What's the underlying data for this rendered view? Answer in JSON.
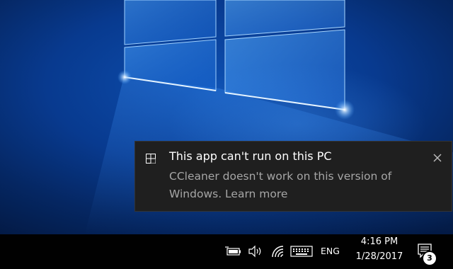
{
  "notification": {
    "title": "This app can't run on this PC",
    "body_line1": "CCleaner doesn't work on this version of",
    "body_line2": "Windows. Learn more",
    "app_icon": "app-window-icon",
    "close_icon": "close-icon"
  },
  "taskbar": {
    "tray_icons": [
      "battery-icon",
      "volume-icon",
      "wifi-icon",
      "keyboard-icon"
    ],
    "language": "ENG",
    "time": "4:16 PM",
    "date": "1/28/2017",
    "action_center_icon": "action-center-icon",
    "notification_count": "3"
  },
  "colors": {
    "toast_bg": "#1f1f1f",
    "taskbar_bg": "#010101",
    "body_text": "#a6a6a6",
    "accent_blue": "#0d4fb0"
  }
}
